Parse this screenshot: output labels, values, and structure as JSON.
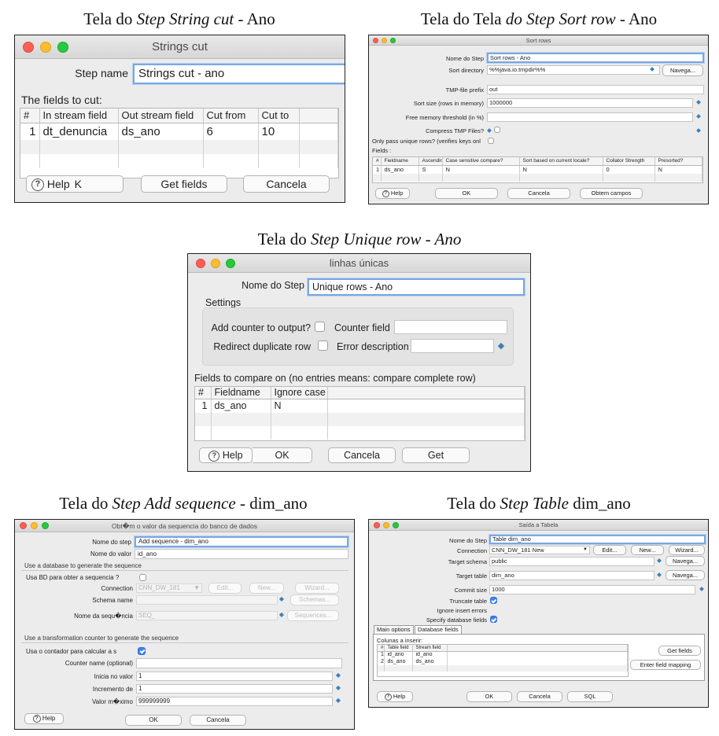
{
  "captions": {
    "c1": {
      "a": "Tela do ",
      "b": "Step String cut",
      "c": " - Ano"
    },
    "c2": {
      "a": "Tela do Tela ",
      "b": "do Step Sort row",
      "c": " - Ano"
    },
    "c3": {
      "a": "Tela do ",
      "b": "Step Unique row - Ano",
      "c": ""
    },
    "c4": {
      "a": "Tela do ",
      "b": "Step Add sequence",
      "c": " - dim_ano"
    },
    "c5": {
      "a": "Tela do ",
      "b": "Step Table",
      "c": " dim_ano"
    }
  },
  "strings_cut": {
    "title": "Strings cut",
    "step_name_label": "Step name",
    "step_name_value": "Strings cut - ano",
    "fields_label": "The fields to cut:",
    "columns": [
      "#",
      "In stream field",
      "Out stream field",
      "Cut from",
      "Cut to"
    ],
    "row": {
      "num": "1",
      "in": "dt_denuncia",
      "out": "ds_ano",
      "from": "6",
      "to": "10"
    },
    "help": "Help",
    "ok_frag": "K",
    "get_fields": "Get fields",
    "cancel": "Cancela"
  },
  "sort_rows": {
    "title": "Sort rows",
    "step_label": "Nome do Step",
    "step_value": "Sort rows - Ano",
    "dir_label": "Sort directory",
    "dir_value": "%%java.io.tmpdir%%",
    "browse": "Navega...",
    "prefix_label": "TMP-file prefix",
    "prefix_value": "out",
    "size_label": "Sort size (rows in memory)",
    "size_value": "1000000",
    "freemem_label": "Free memory threshold (in %)",
    "compress_label": "Compress TMP Files?",
    "unique_label": "Only pass unique rows? (verifies keys onl",
    "fields_label": "Fields :",
    "columns": [
      "#",
      "Fieldname",
      "Ascending",
      "Case sensitive compare?",
      "Sort based on current locale?",
      "Collator Strength",
      "Presorted?"
    ],
    "row": [
      "1",
      "ds_ano",
      "S",
      "N",
      "N",
      "0",
      "N"
    ],
    "help": "Help",
    "ok": "OK",
    "cancel": "Cancela",
    "get": "Obtem campos"
  },
  "unique_rows": {
    "title": "linhas únicas",
    "step_label": "Nome do Step",
    "step_value": "Unique rows - Ano",
    "settings": "Settings",
    "add_counter": "Add counter to output?",
    "counter_field": "Counter field",
    "redirect": "Redirect duplicate row",
    "error_desc": "Error description",
    "compare_label": "Fields to compare on (no entries means: compare complete row)",
    "columns": [
      "#",
      "Fieldname",
      "Ignore case"
    ],
    "row": [
      "1",
      "ds_ano",
      "N"
    ],
    "help": "Help",
    "ok": "OK",
    "cancel": "Cancela",
    "get": "Get"
  },
  "add_seq": {
    "title": "Obt�m o valor da sequencia do banco de dados",
    "step_label": "Nome do step",
    "step_value": "Add sequence - dim_ano",
    "value_label": "Nome do valor",
    "value_value": "id_ano",
    "sec1": "Use a database to generate the sequence",
    "usabd": "Usa BD para obter a sequencia ?",
    "conn_label": "Connection",
    "conn_value": "CNN_DW_181",
    "edit": "Edit...",
    "new": "New...",
    "wizard": "Wizard...",
    "schema_label": "Schema name",
    "schemas": "Schemas...",
    "seqname_label": "Nome da sequ�ncia",
    "seqname_value": "SEQ_",
    "sequences": "Sequences...",
    "sec2": "Use a transformation counter to generate the sequence",
    "usacont": "Usa o contador para calcular a s",
    "counter_label": "Counter name (optional)",
    "start_label": "Inicia no valor",
    "start_value": "1",
    "inc_label": "Incremento de",
    "inc_value": "1",
    "max_label": "Valor m�ximo",
    "max_value": "999999999",
    "help": "Help",
    "ok": "OK",
    "cancel": "Cancela"
  },
  "table_out": {
    "title": "Saída a Tabela",
    "step_label": "Nome do Step",
    "step_value": "Table dim_ano",
    "conn_label": "Connection",
    "conn_value": "CNN_DW_181 New",
    "edit": "Edit...",
    "new": "New...",
    "wizard": "Wizard...",
    "schema_label": "Target schema",
    "schema_value": "public",
    "browse": "Navega...",
    "table_label": "Target table",
    "table_value": "dim_ano",
    "commit_label": "Commit size",
    "commit_value": "1000",
    "truncate_label": "Truncate table",
    "ignore_label": "Ignore insert errors",
    "specify_label": "Specify database fields",
    "tab1": "Main options",
    "tab2": "Database fields",
    "cols_label": "Colunas a inserir:",
    "columns": [
      "#",
      "Table field",
      "Stream field"
    ],
    "rows": [
      [
        "1",
        "id_ano",
        "id_ano"
      ],
      [
        "2",
        "ds_ano",
        "ds_ano"
      ]
    ],
    "get_fields": "Get fields",
    "enter_mapping": "Enter field mapping",
    "help": "Help",
    "ok": "OK",
    "cancel": "Cancela",
    "sql": "SQL"
  }
}
